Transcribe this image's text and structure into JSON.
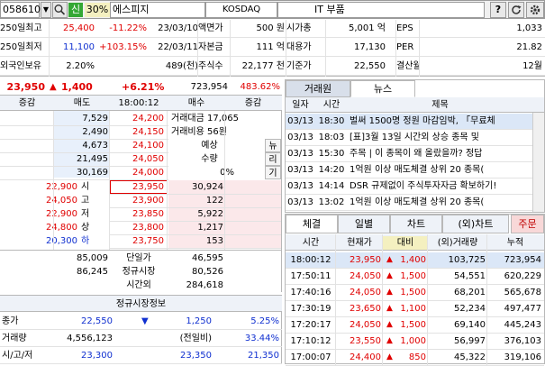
{
  "toolbar": {
    "code": "058610",
    "market_badge": "신",
    "margin": "30%",
    "name": "에스피지",
    "exchange": "KOSDAQ",
    "sector": "IT 부품",
    "help": "?"
  },
  "info": {
    "rows": [
      [
        "250일최고",
        "25,400",
        "-11.22%",
        "23/03/10",
        "액면가",
        "500 원",
        "시가총",
        "5,001 억",
        "EPS",
        "1,033"
      ],
      [
        "250일최저",
        "11,100",
        "+103.15%",
        "22/03/11",
        "자본금",
        "111 억",
        "대용가",
        "17,130",
        "PER",
        "21.82"
      ],
      [
        "외국인보유",
        "2.20%",
        "",
        "489(천)",
        "주식수",
        "22,177 천",
        "기준가",
        "22,550",
        "결산월",
        "12월"
      ]
    ]
  },
  "price": {
    "current": "23,950",
    "arrow": "▲",
    "change": "1,400",
    "pct": "+6.21%",
    "volume": "723,954",
    "vol_pct": "483.62%"
  },
  "orderbook": {
    "headers": [
      "증감",
      "매도",
      "18:00:12",
      "매수",
      "증감"
    ],
    "asks": [
      {
        "qty": "7,529",
        "price": "24,200"
      },
      {
        "qty": "2,490",
        "price": "24,150"
      },
      {
        "qty": "4,673",
        "price": "24,100"
      },
      {
        "qty": "21,495",
        "price": "24,050"
      },
      {
        "qty": "30,169",
        "price": "24,000"
      }
    ],
    "bids": [
      {
        "price": "23,950",
        "qty": "30,924"
      },
      {
        "price": "23,900",
        "qty": "122"
      },
      {
        "price": "23,850",
        "qty": "5,922"
      },
      {
        "price": "23,800",
        "qty": "1,217"
      },
      {
        "price": "23,750",
        "qty": "153"
      }
    ],
    "summary": [
      "거래대금 17,065",
      "거래비용 56원",
      "예상",
      "수량",
      "0%"
    ],
    "side_labels": [
      "뉴",
      "리",
      "기"
    ],
    "left_prices": [
      {
        "price": "22,900",
        "label": "시"
      },
      {
        "price": "24,050",
        "label": "고"
      },
      {
        "price": "22,900",
        "label": "저"
      },
      {
        "price": "24,800",
        "label": "상"
      },
      {
        "price": "20,300",
        "label": "하"
      }
    ],
    "totals": {
      "ask": "85,009",
      "label1": "단일가",
      "bid": "46,595",
      "ask2": "86,245",
      "label2": "정규시장",
      "bid2": "80,526",
      "label3": "시간외",
      "bid3": "284,618"
    }
  },
  "regular": {
    "title": "정규시장정보",
    "rows": [
      {
        "label": "종가",
        "v1": "22,550",
        "arrow": "▼",
        "v2": "1,250",
        "v3": "5.25%"
      },
      {
        "label": "거래량",
        "v1": "4,556,123",
        "v2": "(전일비)",
        "v3": "33.44%"
      },
      {
        "label": "시/고/저",
        "v1": "23,300",
        "v2": "23,350",
        "v3": "21,350"
      }
    ]
  },
  "news": {
    "tabs": [
      "거래원",
      "뉴스"
    ],
    "headers": [
      "일자",
      "시간",
      "제목"
    ],
    "rows": [
      [
        "03/13",
        "18:30",
        "벌써 1500명 정원 마감임박, 「무료체"
      ],
      [
        "03/13",
        "18:03",
        "[표]3월 13일 시간외 상승 종목 및"
      ],
      [
        "03/13",
        "15:30",
        "주목 | 이 종목이 왜 올랐을까? 정답"
      ],
      [
        "03/13",
        "14:20",
        "1억원 이상 매도체결 상위 20 종목("
      ],
      [
        "03/13",
        "14:14",
        "DSR 규제없이 주식투자자금 확보하기!"
      ],
      [
        "03/13",
        "13:02",
        "1억원 이상 매도체결 상위 20 종목("
      ]
    ]
  },
  "trades": {
    "tabs": [
      "체결",
      "일별",
      "차트",
      "(외)차트",
      "주문"
    ],
    "headers": [
      "시간",
      "현재가",
      "대비",
      "(외)거래량",
      "누적"
    ],
    "rows": [
      [
        "18:00:12",
        "23,950",
        "1,400",
        "103,725",
        "723,954"
      ],
      [
        "17:50:11",
        "24,050",
        "1,500",
        "54,551",
        "620,229"
      ],
      [
        "17:40:16",
        "24,050",
        "1,500",
        "68,201",
        "565,678"
      ],
      [
        "17:30:19",
        "23,650",
        "1,100",
        "52,234",
        "497,477"
      ],
      [
        "17:20:17",
        "24,050",
        "1,500",
        "69,140",
        "445,243"
      ],
      [
        "17:10:12",
        "23,550",
        "1,000",
        "56,997",
        "376,103"
      ],
      [
        "17:00:07",
        "24,400",
        "850",
        "45,322",
        "319,106"
      ]
    ]
  }
}
